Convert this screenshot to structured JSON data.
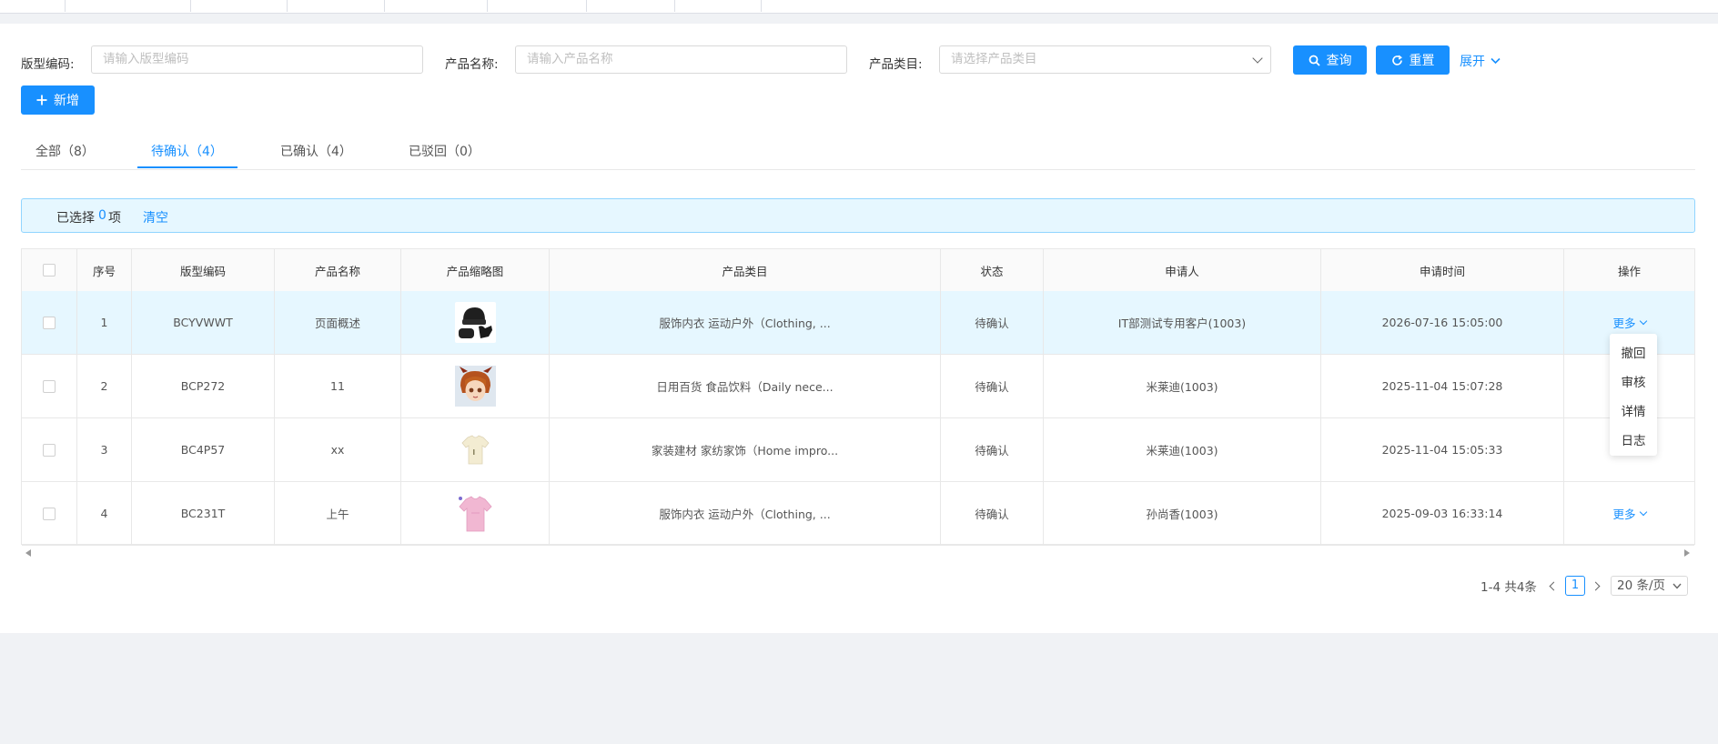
{
  "filters": {
    "code_label": "版型编码:",
    "code_placeholder": "请输入版型编码",
    "name_label": "产品名称:",
    "name_placeholder": "请输入产品名称",
    "category_label": "产品类目:",
    "category_placeholder": "请选择产品类目"
  },
  "buttons": {
    "search": "查询",
    "reset": "重置",
    "expand": "展开",
    "add": "新增"
  },
  "tabs": [
    {
      "label": "全部（8）"
    },
    {
      "label": "待确认（4）"
    },
    {
      "label": "已确认（4）"
    },
    {
      "label": "已驳回（0）"
    }
  ],
  "selection": {
    "prefix": "已选择",
    "count": "0",
    "suffix": "项",
    "clear": "清空"
  },
  "table": {
    "headers": [
      "序号",
      "版型编码",
      "产品名称",
      "产品缩略图",
      "产品类目",
      "状态",
      "申请人",
      "申请时间",
      "操作"
    ],
    "rows": [
      {
        "index": "1",
        "code": "BCYVWWT",
        "name": "页面概述",
        "category": "服饰内衣 运动户外（Clothing, ...",
        "status": "待确认",
        "applicant": "IT部测试专用客户(1003)",
        "time": "2026-07-16 15:05:00",
        "action": "更多"
      },
      {
        "index": "2",
        "code": "BCP272",
        "name": "11",
        "category": "日用百货 食品饮料（Daily nece...",
        "status": "待确认",
        "applicant": "米莱迪(1003)",
        "time": "2025-11-04 15:07:28",
        "action": ""
      },
      {
        "index": "3",
        "code": "BC4P57",
        "name": "xx",
        "category": "家装建材 家纺家饰（Home impro...",
        "status": "待确认",
        "applicant": "米莱迪(1003)",
        "time": "2025-11-04 15:05:33",
        "action": ""
      },
      {
        "index": "4",
        "code": "BC231T",
        "name": "上午",
        "category": "服饰内衣 运动户外（Clothing, ...",
        "status": "待确认",
        "applicant": "孙尚香(1003)",
        "time": "2025-09-03 16:33:14",
        "action": "更多"
      }
    ]
  },
  "dropdown": {
    "items": [
      "撤回",
      "审核",
      "详情",
      "日志"
    ]
  },
  "pagination": {
    "summary": "1-4 共4条",
    "current": "1",
    "page_size": "20 条/页"
  },
  "colors": {
    "primary": "#1890ff",
    "selected_row": "#e6f7ff"
  }
}
